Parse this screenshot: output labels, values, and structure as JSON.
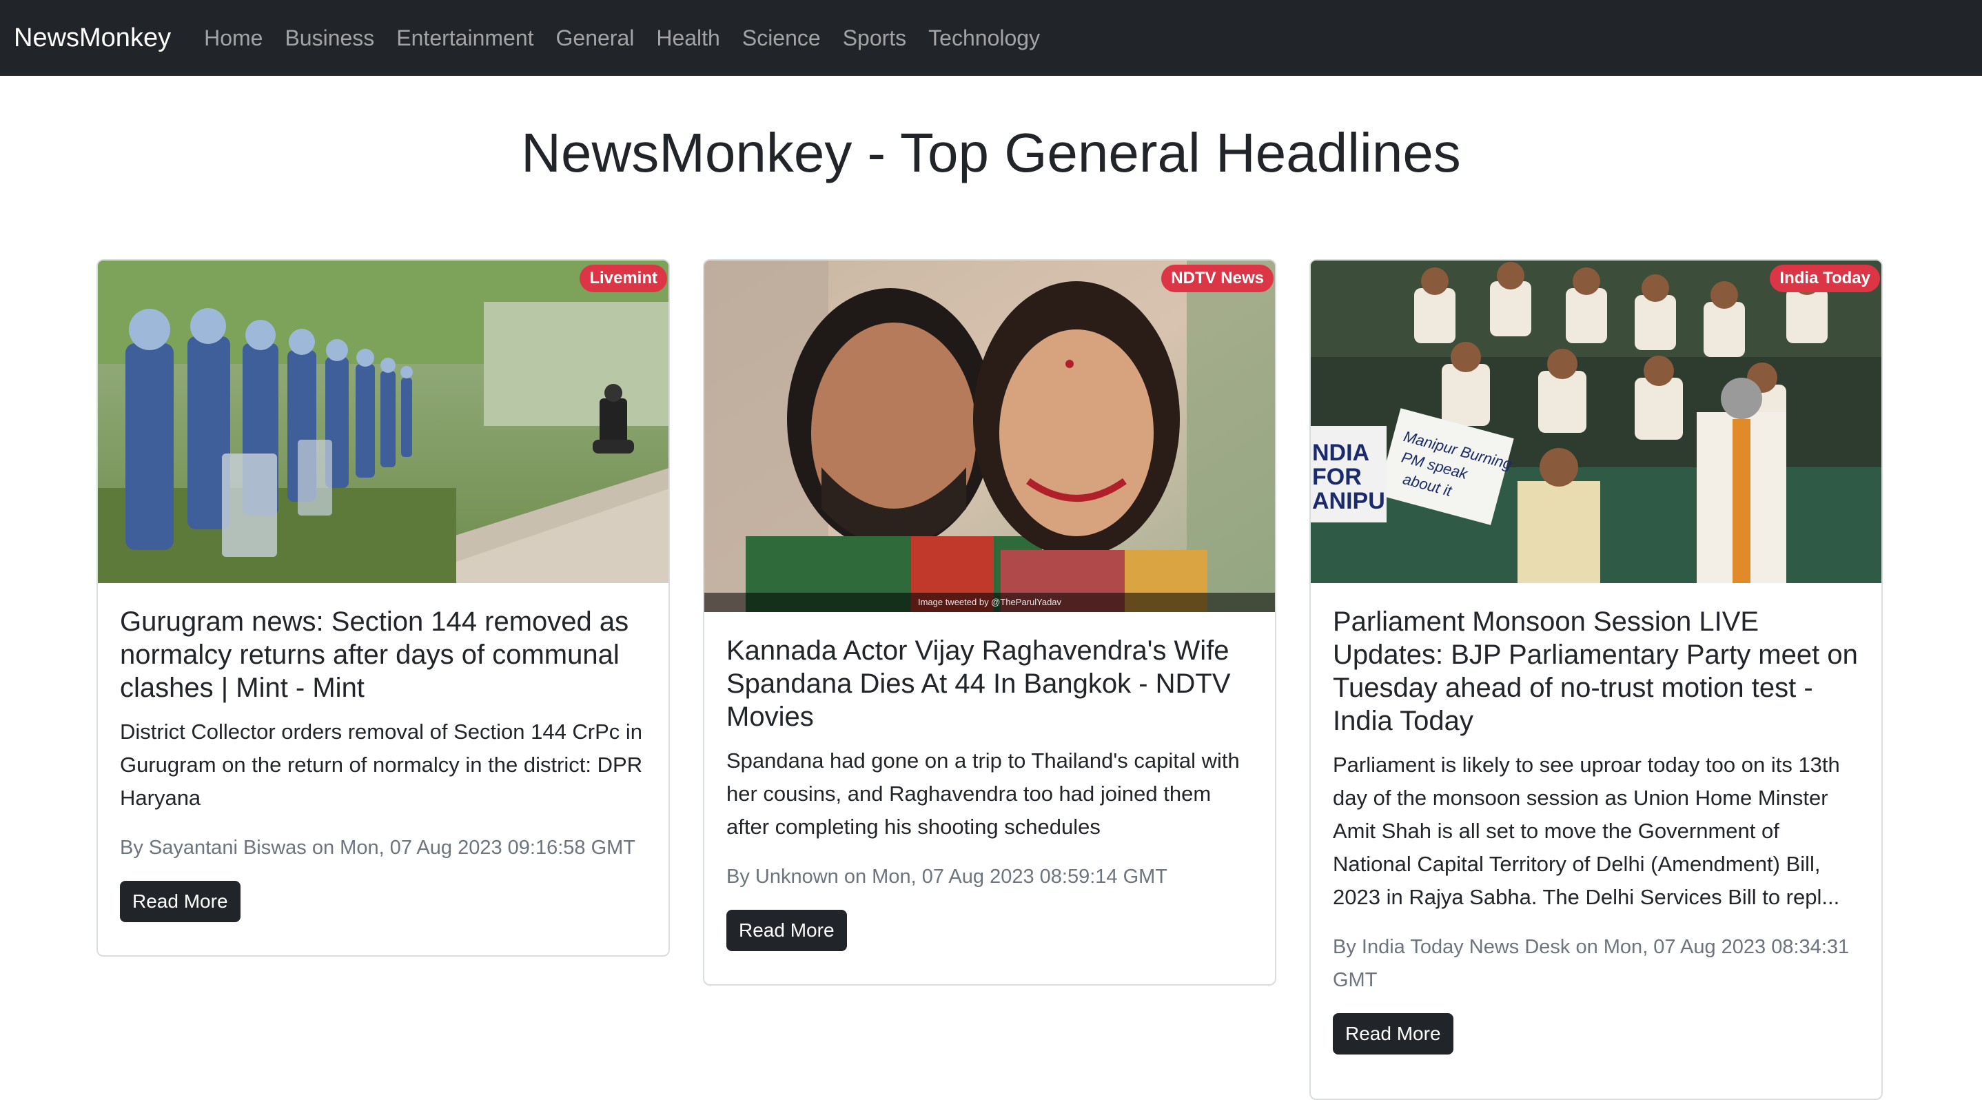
{
  "navbar": {
    "brand": "NewsMonkey",
    "links": [
      "Home",
      "Business",
      "Entertainment",
      "General",
      "Health",
      "Science",
      "Sports",
      "Technology"
    ]
  },
  "page": {
    "title": "NewsMonkey - Top General Headlines"
  },
  "articles": [
    {
      "source": "Livemint",
      "title": "Gurugram news: Section 144 removed as normalcy returns after days of communal clashes | Mint - Mint",
      "description": "District Collector orders removal of Section 144 CrPc in Gurugram on the return of normalcy in the district: DPR Haryana",
      "meta": "By Sayantani Biswas on Mon, 07 Aug 2023 09:16:58 GMT",
      "button": "Read More"
    },
    {
      "source": "NDTV News",
      "title": "Kannada Actor Vijay Raghavendra's Wife Spandana Dies At 44 In Bangkok - NDTV Movies",
      "description": "Spandana had gone on a trip to Thailand's capital with her cousins, and Raghavendra too had joined them after completing his shooting schedules",
      "meta": "By Unknown on Mon, 07 Aug 2023 08:59:14 GMT",
      "button": "Read More",
      "image_caption": "Image tweeted by @TheParulYadav"
    },
    {
      "source": "India Today",
      "title": "Parliament Monsoon Session LIVE Updates: BJP Parliamentary Party meet on Tuesday ahead of no-trust motion test - India Today",
      "description": "Parliament is likely to see uproar today too on its 13th day of the monsoon session as Union Home Minster Amit Shah is all set to move the Government of National Capital Territory of Delhi (Amendment) Bill, 2023 in Rajya Sabha. The Delhi Services Bill to repl...",
      "meta": "By India Today News Desk on Mon, 07 Aug 2023 08:34:31 GMT",
      "button": "Read More"
    }
  ],
  "colors": {
    "navbar_bg": "#212529",
    "badge_bg": "#dc3545",
    "button_bg": "#212529",
    "meta_text": "#6c757d"
  }
}
